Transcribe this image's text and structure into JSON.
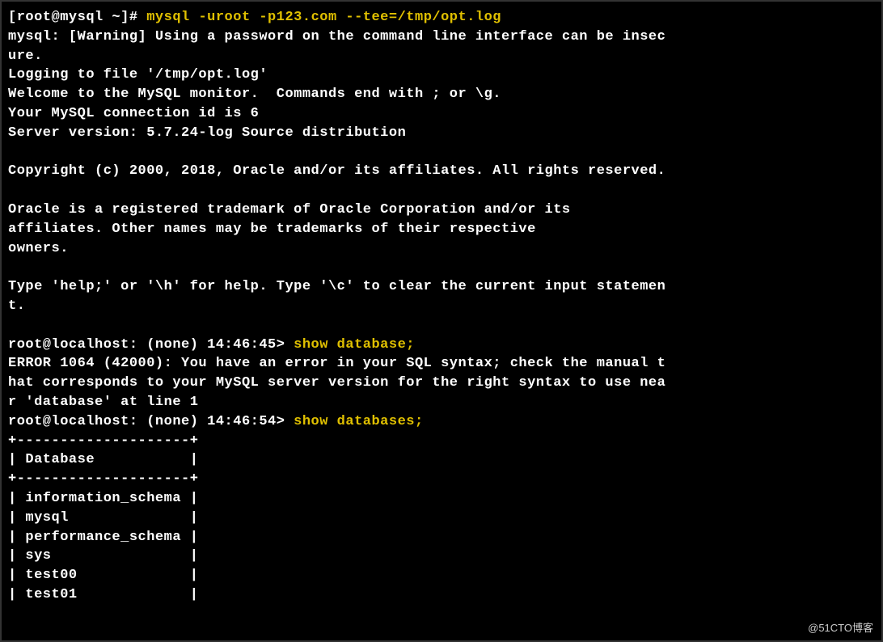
{
  "shell_prompt": "[root@mysql ~]# ",
  "shell_command": "mysql -uroot -p123.com --tee=/tmp/opt.log",
  "banner": {
    "line1": "mysql: [Warning] Using a password on the command line interface can be insec",
    "line2": "ure.",
    "line3": "Logging to file '/tmp/opt.log'",
    "line4": "Welcome to the MySQL monitor.  Commands end with ; or \\g.",
    "line5": "Your MySQL connection id is 6",
    "line6": "Server version: 5.7.24-log Source distribution",
    "line7": "Copyright (c) 2000, 2018, Oracle and/or its affiliates. All rights reserved.",
    "line8": "Oracle is a registered trademark of Oracle Corporation and/or its",
    "line9": "affiliates. Other names may be trademarks of their respective",
    "line10": "owners.",
    "line11": "Type 'help;' or '\\h' for help. Type '\\c' to clear the current input statemen",
    "line12": "t."
  },
  "mysql1": {
    "prompt": "root@localhost: (none) 14:46:45> ",
    "cmd": "show database;"
  },
  "error": {
    "line1": "ERROR 1064 (42000): You have an error in your SQL syntax; check the manual t",
    "line2": "hat corresponds to your MySQL server version for the right syntax to use nea",
    "line3": "r 'database' at line 1"
  },
  "mysql2": {
    "prompt": "root@localhost: (none) 14:46:54> ",
    "cmd": "show databases;"
  },
  "table": {
    "border": "+--------------------+",
    "header": "| Database           |",
    "rows": [
      "| information_schema |",
      "| mysql              |",
      "| performance_schema |",
      "| sys                |",
      "| test00             |",
      "| test01             |"
    ]
  },
  "databases": [
    "information_schema",
    "mysql",
    "performance_schema",
    "sys",
    "test00",
    "test01"
  ],
  "watermark": "@51CTO博客"
}
